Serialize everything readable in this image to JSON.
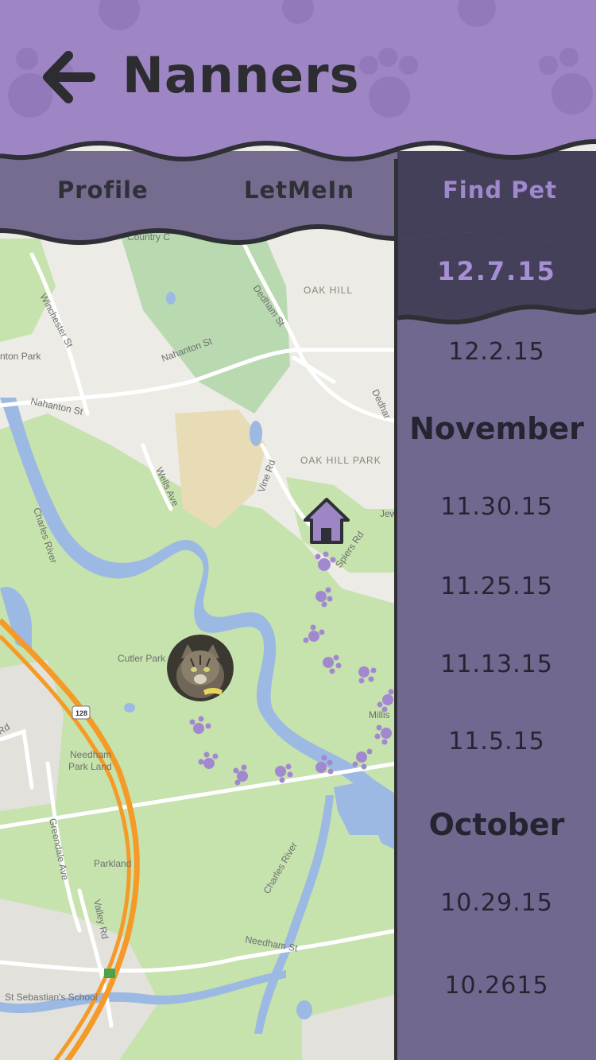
{
  "header": {
    "title": "Nanners",
    "back_icon": "arrow-left-icon"
  },
  "tabs": [
    {
      "label": "Profile",
      "active": false
    },
    {
      "label": "LetMeIn",
      "active": false
    },
    {
      "label": "Find Pet",
      "active": true
    }
  ],
  "dates": {
    "selected": "12.7.15",
    "december": [
      "12.2.15"
    ],
    "november_label": "November",
    "november": [
      "11.30.15",
      "11.25.15",
      "11.13.15",
      "11.5.15"
    ],
    "october_label": "October",
    "october": [
      "10.29.15",
      "10.2615"
    ]
  },
  "map": {
    "labels": {
      "country": "Country C",
      "oak_hill": "OAK HILL",
      "oak_hill_park": "OAK HILL PARK",
      "winchester": "Winchester St",
      "nahanton_park": "nton Park",
      "nahanton_st1": "Nahanton St",
      "nahanton_st2": "Nahanton St",
      "dedham_st1": "Dedham St",
      "dedham_st2": "Dedhar",
      "wells_ave": "Wells Ave",
      "vine_rd": "Vine Rd",
      "spiers_rd": "Spiers Rd",
      "jew": "Jew",
      "charles_river": "Charles River",
      "charles_river2": "Charles River",
      "cutler_park": "Cutler Park",
      "millis": "Millis",
      "needham_park_land": "Needham",
      "needham_park_land2": "Park Land",
      "parkland": "Parkland",
      "greendale": "Greendale Ave",
      "valley_rd": "Valley Rd",
      "needham_st": "Needham St",
      "st_sebastians": "St Sebastian's School",
      "route_128": "128",
      "rd": "Rd"
    },
    "colors": {
      "park": "#c6e2ad",
      "water": "#9cb9e4",
      "highway": "#f59a26",
      "land": "#ecebe5"
    }
  },
  "colors": {
    "header": "#9e86c4",
    "tab_bar": "#756c8f",
    "sidebar": "#716890",
    "selected": "#45405a",
    "accent": "#a78fd4"
  },
  "icons": {
    "home": "home-icon",
    "paw": "paw-print-icon",
    "pet": "pet-photo"
  }
}
